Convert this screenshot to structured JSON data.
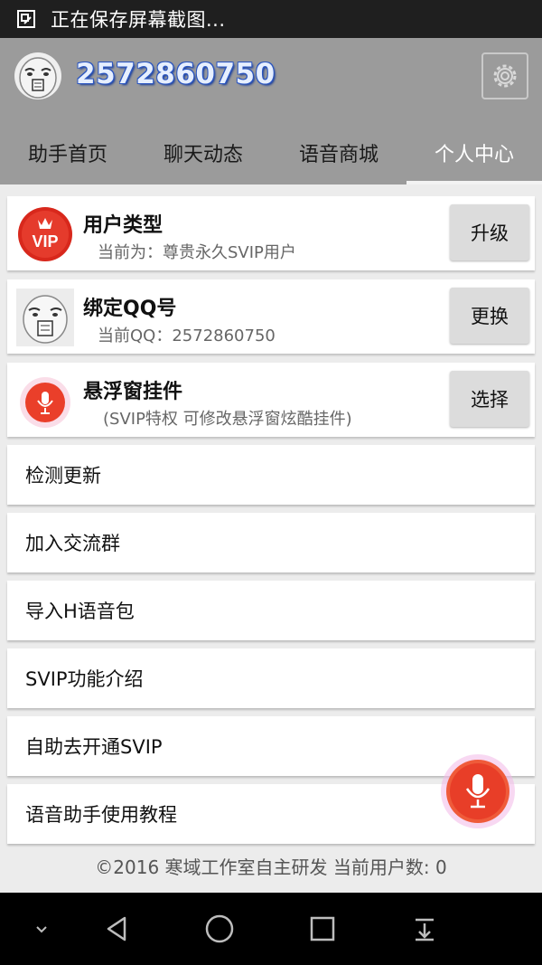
{
  "status_bar": {
    "text": "正在保存屏幕截图..."
  },
  "header": {
    "user_id": "2572860750",
    "tabs": [
      "助手首页",
      "聊天动态",
      "语音商城",
      "个人中心"
    ],
    "active_tab": "个人中心"
  },
  "cards": [
    {
      "title": "用户类型",
      "subtitle": "当前为：尊贵永久SVIP用户",
      "button": "升级",
      "icon": "vip-badge-icon",
      "badge_text": "VIP"
    },
    {
      "title": "绑定QQ号",
      "subtitle": "当前QQ：2572860750",
      "button": "更换",
      "icon": "meme-avatar-icon"
    },
    {
      "title": "悬浮窗挂件",
      "subtitle": "(SVIP特权 可修改悬浮窗炫酷挂件)",
      "button": "选择",
      "icon": "microphone-icon"
    }
  ],
  "menu": [
    "检测更新",
    "加入交流群",
    "导入H语音包",
    "SVIP功能介绍",
    "自助去开通SVIP",
    "语音助手使用教程"
  ],
  "footer": {
    "text": "©2016 寒域工作室自主研发 当前用户数: 0"
  },
  "colors": {
    "header_bg": "#9b9b9b",
    "accent_red": "#e53b2c",
    "user_id_outline": "#2a55c0"
  }
}
